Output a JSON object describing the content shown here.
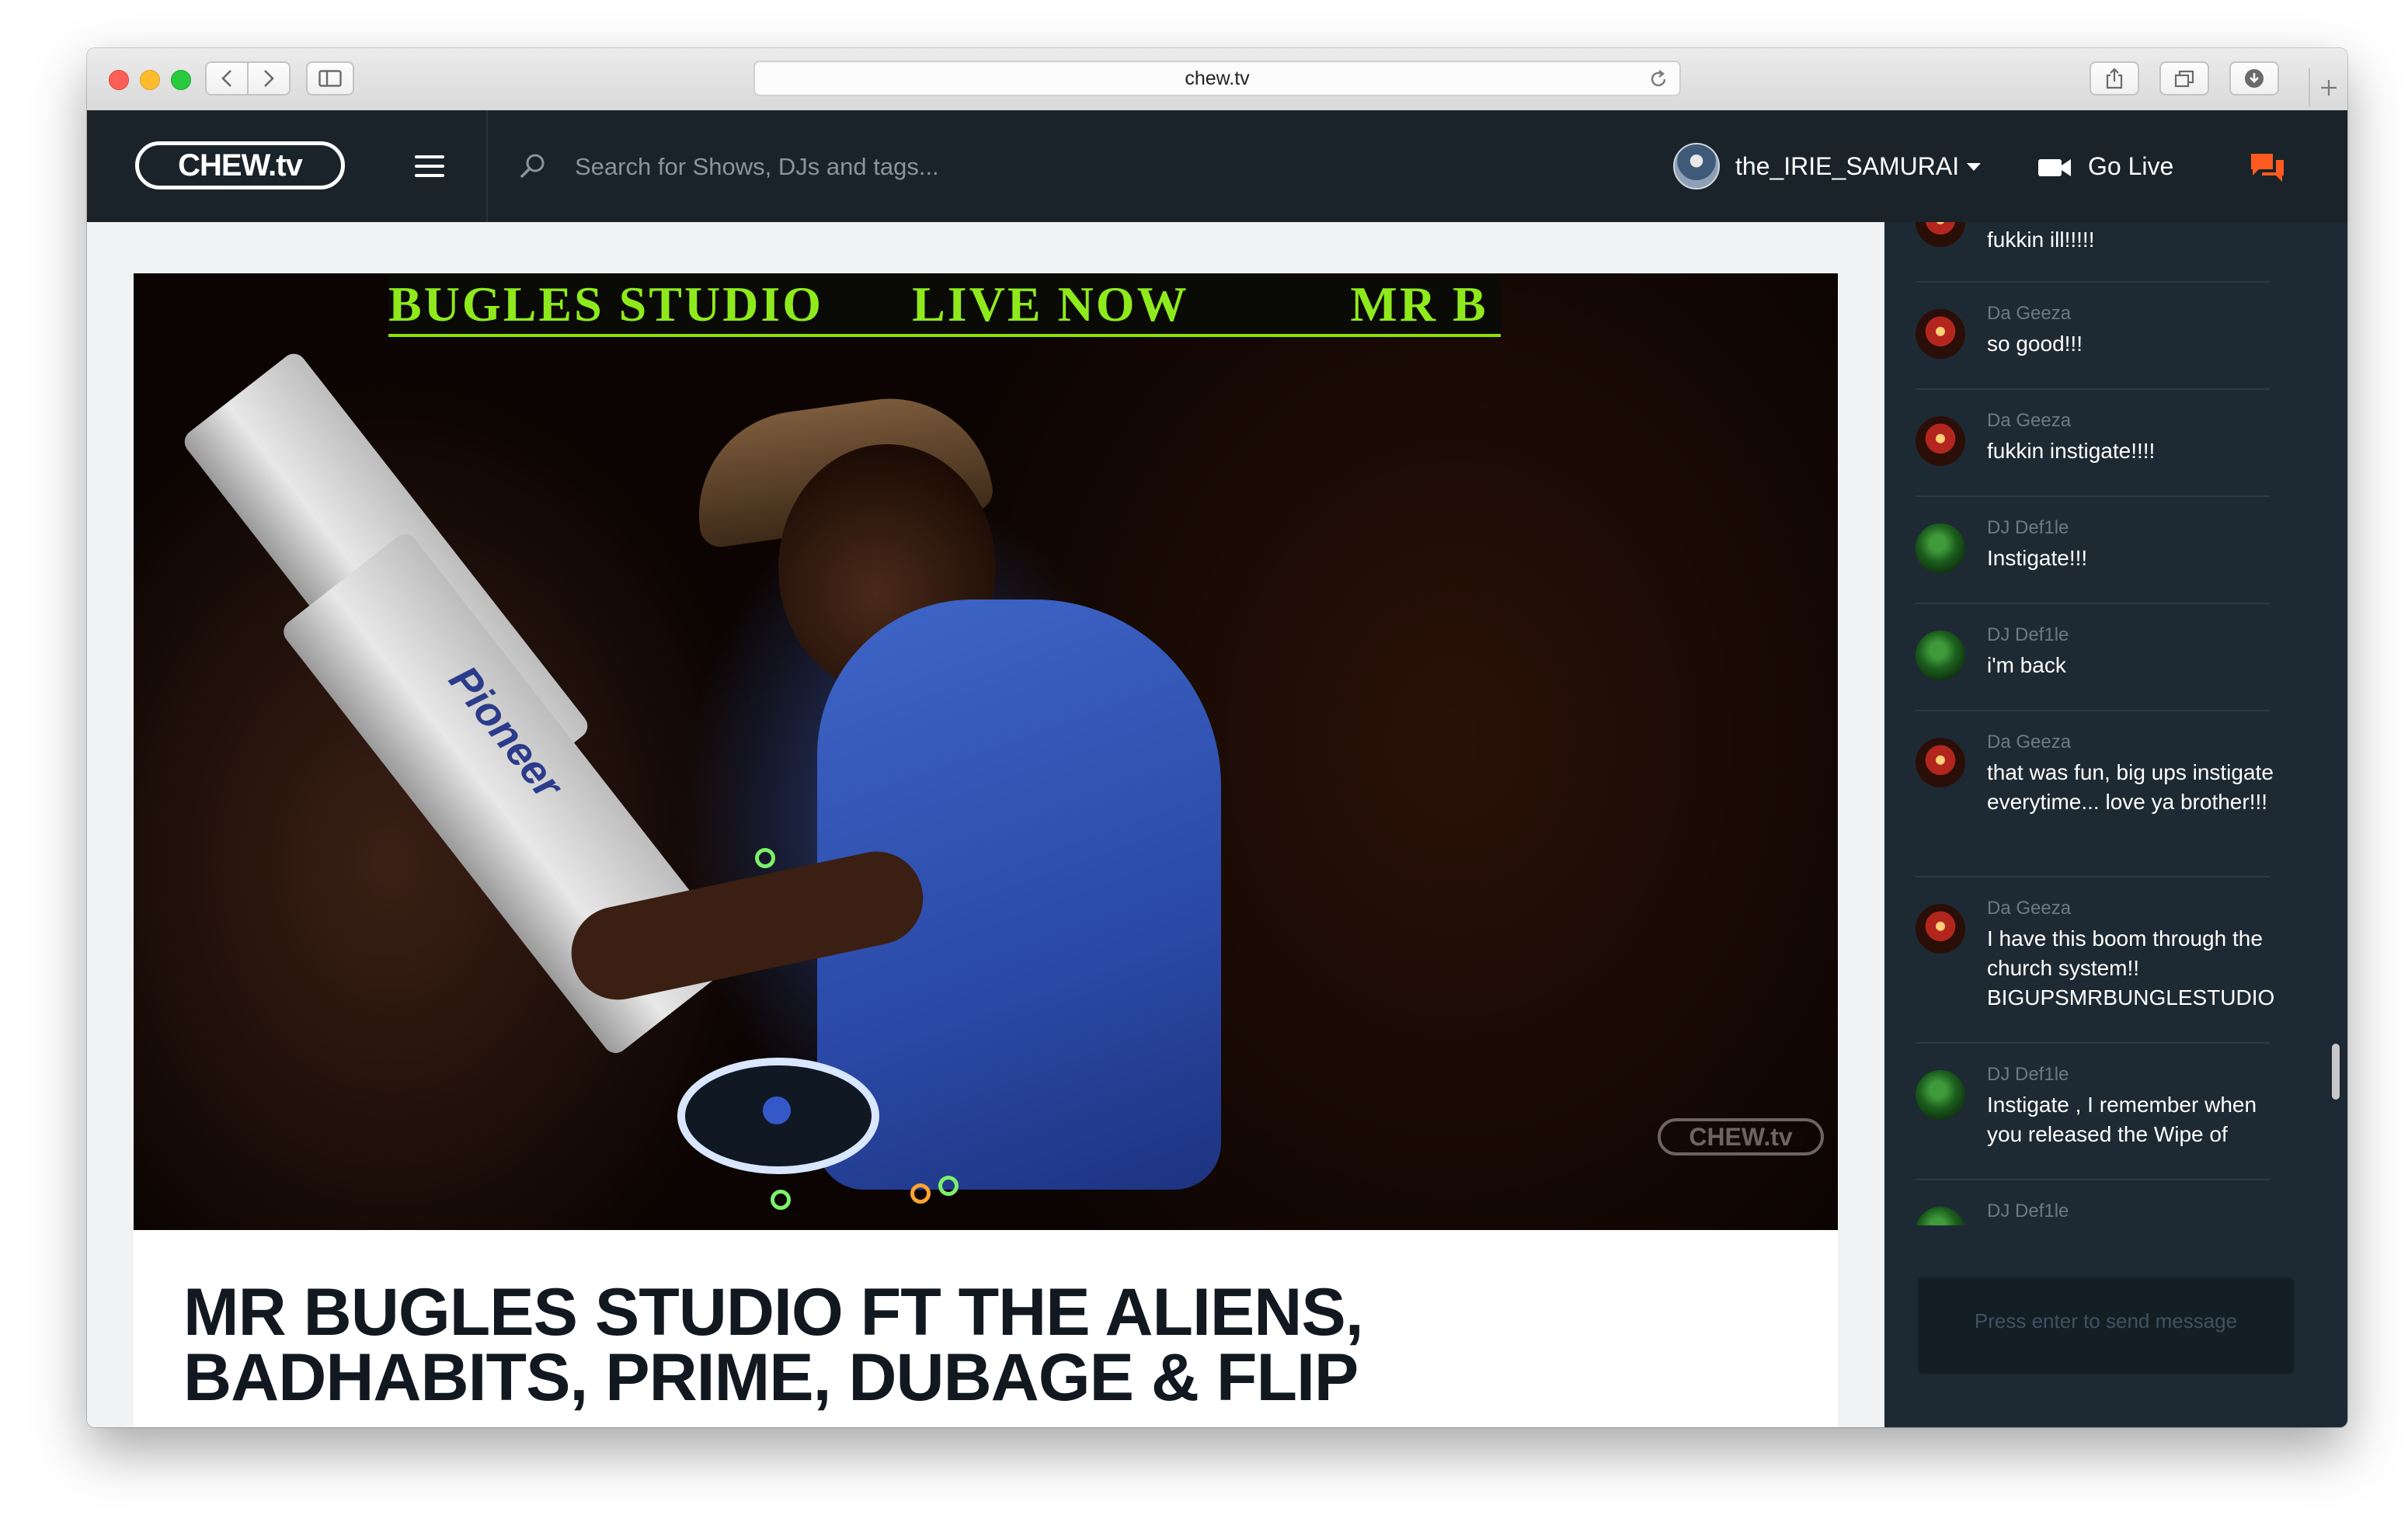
{
  "browser": {
    "url": "chew.tv"
  },
  "header": {
    "logo_text": "CHEW.tv",
    "search_placeholder": "Search for Shows, DJs and tags...",
    "username": "the_IRIE_SAMURAI",
    "go_live_label": "Go Live",
    "accent_color": "#ff5a1f"
  },
  "video": {
    "ticker_text": "BUGLES STUDIO      LIVE NOW           MR B",
    "brand_label": "Pioneer",
    "watermark": "CHEW.tv"
  },
  "show": {
    "title_line_1": "MR BUGLES STUDIO FT THE ALIENS,",
    "title_line_2": "BADHABITS, PRIME, DUBAGE & FLIP"
  },
  "chat": {
    "messages": [
      {
        "author": "",
        "text": "fukkin ill!!!!!",
        "avatar": "geeza"
      },
      {
        "author": "Da Geeza",
        "text": "so good!!!",
        "avatar": "geeza"
      },
      {
        "author": "Da Geeza",
        "text": "fukkin instigate!!!!",
        "avatar": "geeza"
      },
      {
        "author": "DJ Def1le",
        "text": "Instigate!!!",
        "avatar": "deft"
      },
      {
        "author": "DJ Def1le",
        "text": "i'm back",
        "avatar": "deft"
      },
      {
        "author": "Da Geeza",
        "text": "that was fun, big ups instigate everytime... love ya brother!!!",
        "avatar": "geeza"
      },
      {
        "author": "Da Geeza",
        "text": "I have this boom through the church system!! BIGUPSMRBUNGLESTUDIO",
        "avatar": "geeza"
      },
      {
        "author": "DJ Def1le",
        "text": "Instigate , I remember when you released the Wipe of",
        "avatar": "deft"
      },
      {
        "author": "DJ Def1le",
        "text": "",
        "avatar": "deft"
      }
    ],
    "input_placeholder": "Press enter to send message"
  }
}
